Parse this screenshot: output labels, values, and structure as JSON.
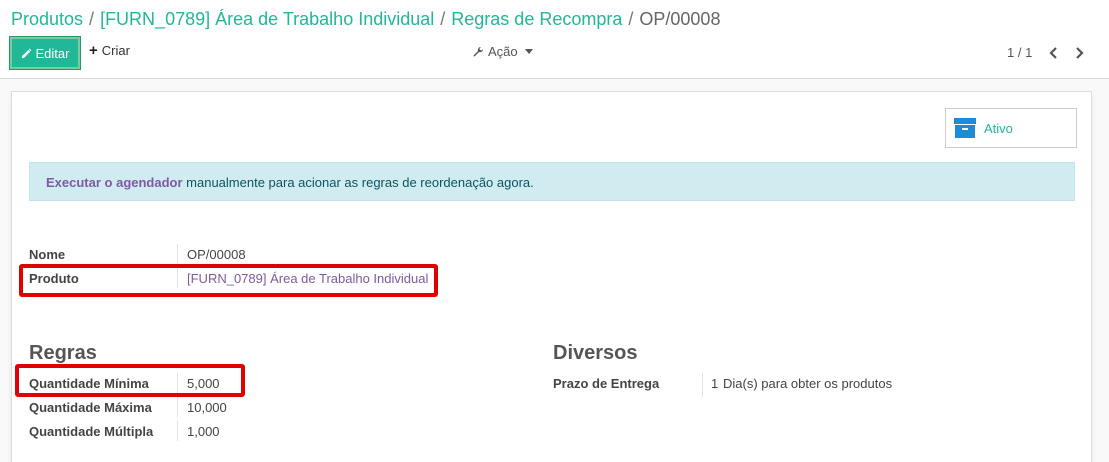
{
  "breadcrumb": {
    "items": [
      "Produtos",
      "[FURN_0789] Área de Trabalho Individual",
      "Regras de Recompra"
    ],
    "current": "OP/00008",
    "separator": "/"
  },
  "toolbar": {
    "edit_label": "Editar",
    "create_label": "Criar",
    "action_label": "Ação"
  },
  "pager": {
    "value": "1 / 1"
  },
  "status_button": {
    "label": "Ativo"
  },
  "alert": {
    "link_text": "Executar o agendador",
    "text": " manualmente para acionar as regras de reordenação agora."
  },
  "fields": {
    "name": {
      "label": "Nome",
      "value": "OP/00008"
    },
    "product": {
      "label": "Produto",
      "value": "[FURN_0789] Área de Trabalho Individual"
    }
  },
  "rules": {
    "title": "Regras",
    "min_qty": {
      "label": "Quantidade Mínima",
      "value": "5,000"
    },
    "max_qty": {
      "label": "Quantidade Máxima",
      "value": "10,000"
    },
    "multiple_qty": {
      "label": "Quantidade Múltipla",
      "value": "1,000"
    }
  },
  "misc": {
    "title": "Diversos",
    "lead_time": {
      "label": "Prazo de Entrega",
      "value": "1",
      "unit": "Dia(s) para obter os produtos"
    }
  },
  "colors": {
    "brand": "#21b799",
    "link": "#7c5aa6",
    "alert_bg": "#d1ecf1",
    "highlight": "#e00000"
  },
  "icons": [
    "pencil-icon",
    "plus-icon",
    "wrench-icon",
    "chevron-left-icon",
    "chevron-right-icon",
    "archive-icon"
  ]
}
